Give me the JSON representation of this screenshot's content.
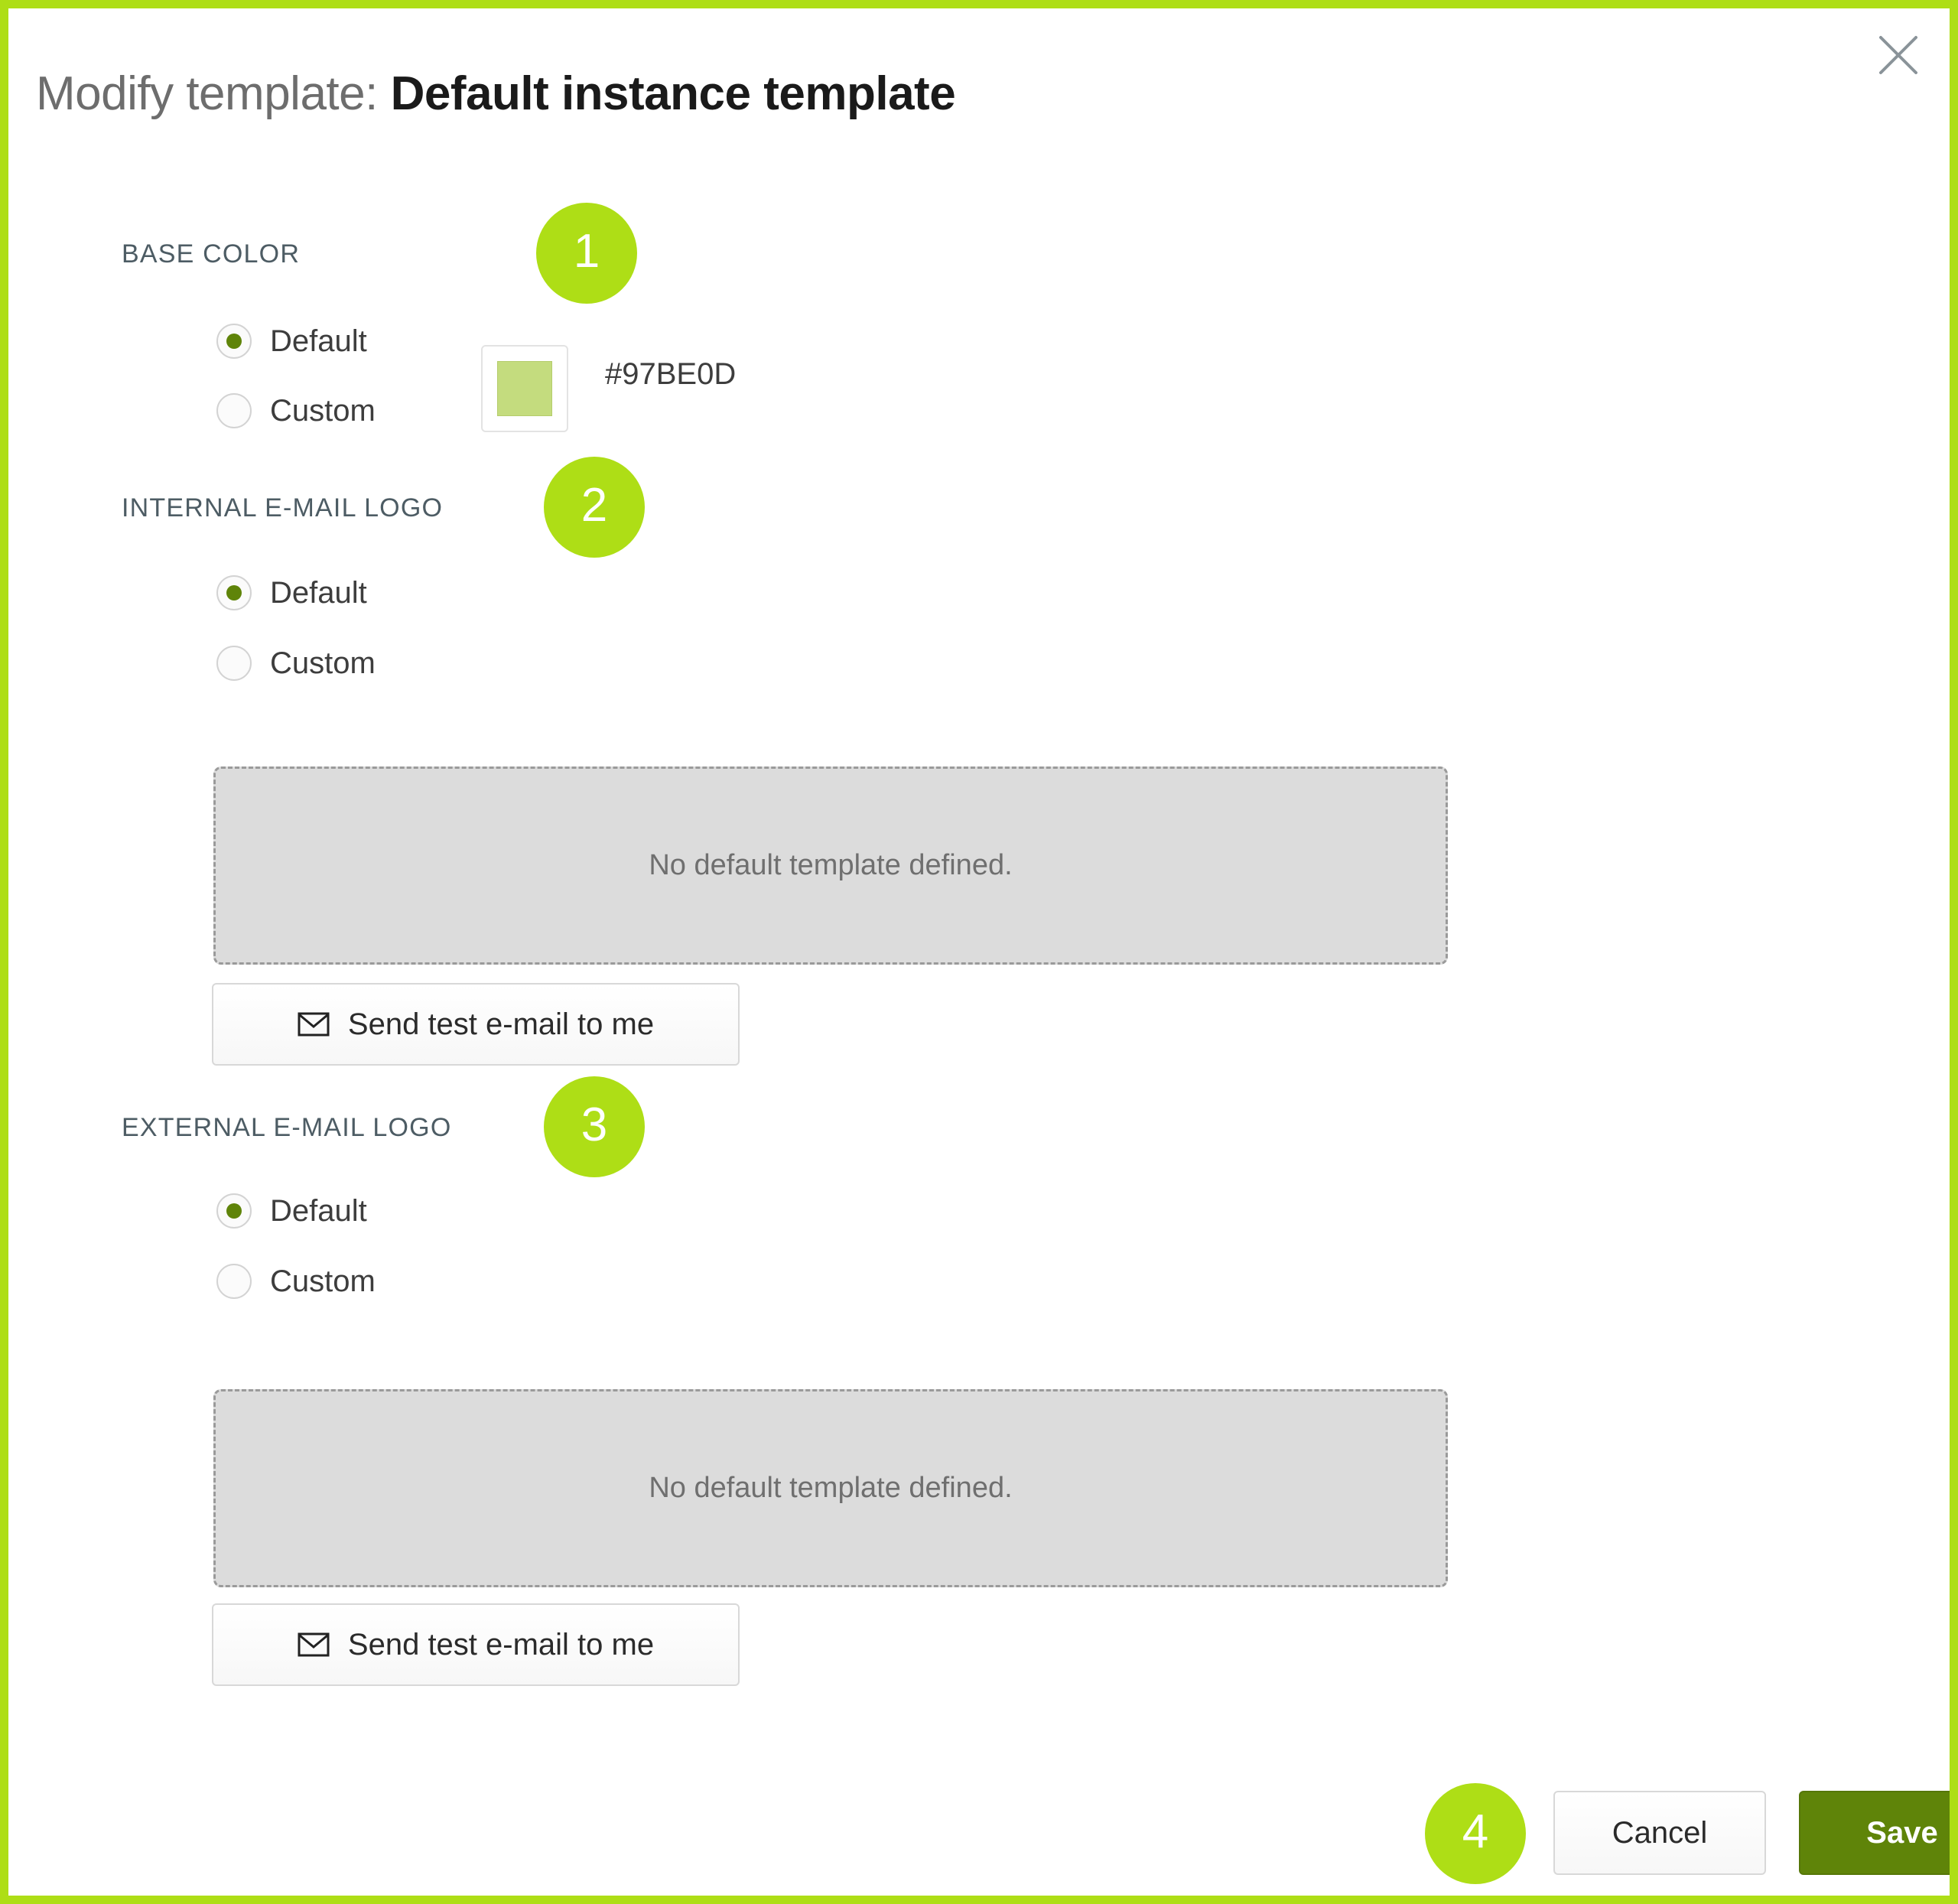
{
  "dialog": {
    "title_prefix": "Modify template:",
    "title_name": "Default instance template",
    "close_icon": "close-icon"
  },
  "sections": {
    "base_color": {
      "label": "BASE COLOR",
      "badge": "1",
      "options": [
        {
          "label": "Default",
          "selected": true
        },
        {
          "label": "Custom",
          "selected": false
        }
      ],
      "swatch_color": "#c4dc7e",
      "color_value": "#97BE0D"
    },
    "internal_email_logo": {
      "label": "INTERNAL E-MAIL LOGO",
      "badge": "2",
      "options": [
        {
          "label": "Default",
          "selected": true
        },
        {
          "label": "Custom",
          "selected": false
        }
      ],
      "preview_text": "No default template defined.",
      "test_button_label": "Send test e-mail to me"
    },
    "external_email_logo": {
      "label": "EXTERNAL E-MAIL LOGO",
      "badge": "3",
      "options": [
        {
          "label": "Default",
          "selected": true
        },
        {
          "label": "Custom",
          "selected": false
        }
      ],
      "preview_text": "No default template defined.",
      "test_button_label": "Send test e-mail to me"
    }
  },
  "footer": {
    "badge": "4",
    "cancel_label": "Cancel",
    "save_label": "Save"
  },
  "colors": {
    "highlight_green": "#aede16",
    "save_green": "#5f8409",
    "radio_dot": "#5f8409"
  }
}
